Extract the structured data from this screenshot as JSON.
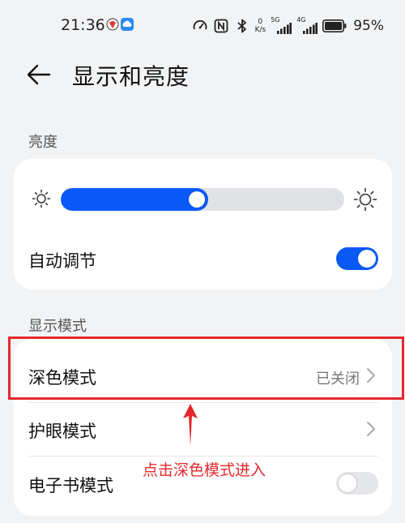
{
  "status_bar": {
    "time": "21:36",
    "speed_value": "0",
    "speed_unit": "K/s",
    "sim1_network": "5G",
    "sim2_network": "4G",
    "battery_percent": "95%",
    "icons": [
      "speedometer-icon",
      "nfc-icon",
      "bluetooth-icon",
      "signal-icon",
      "battery-icon"
    ]
  },
  "header": {
    "title": "显示和亮度",
    "back_icon": "back-arrow-icon"
  },
  "brightness_section": {
    "label": "亮度",
    "slider_level": 0.45,
    "auto_adjust_label": "自动调节",
    "auto_adjust_on": true
  },
  "display_section": {
    "label": "显示模式",
    "dark_mode_label": "深色模式",
    "dark_mode_value": "已关闭",
    "eye_comfort_label": "护眼模式",
    "ebook_mode_label": "电子书模式",
    "ebook_mode_on": false
  },
  "annotation": {
    "text": "点击深色模式进入",
    "color": "#e5282d"
  },
  "colors": {
    "accent": "#0a59f7",
    "background": "#f1f3f5",
    "card": "#ffffff"
  }
}
